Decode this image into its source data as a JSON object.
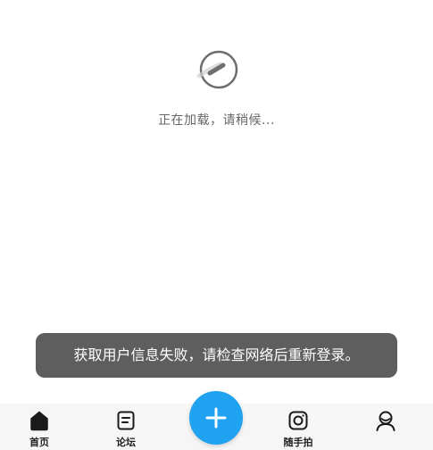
{
  "loading": {
    "text": "正在加载，请稍候..."
  },
  "toast": {
    "message": "获取用户信息失败，请检查网络后重新登录。"
  },
  "tabbar": {
    "items": [
      {
        "label": "首页",
        "icon": "home-icon"
      },
      {
        "label": "论坛",
        "icon": "forum-icon"
      },
      {
        "label": "随手拍",
        "icon": "camera-icon"
      },
      {
        "label": "",
        "icon": "profile-icon"
      }
    ],
    "add_button_icon": "plus-icon"
  },
  "colors": {
    "accent": "#1fa2f0",
    "toast_bg": "#505050",
    "tabbar_bg": "#f6f6f6"
  }
}
